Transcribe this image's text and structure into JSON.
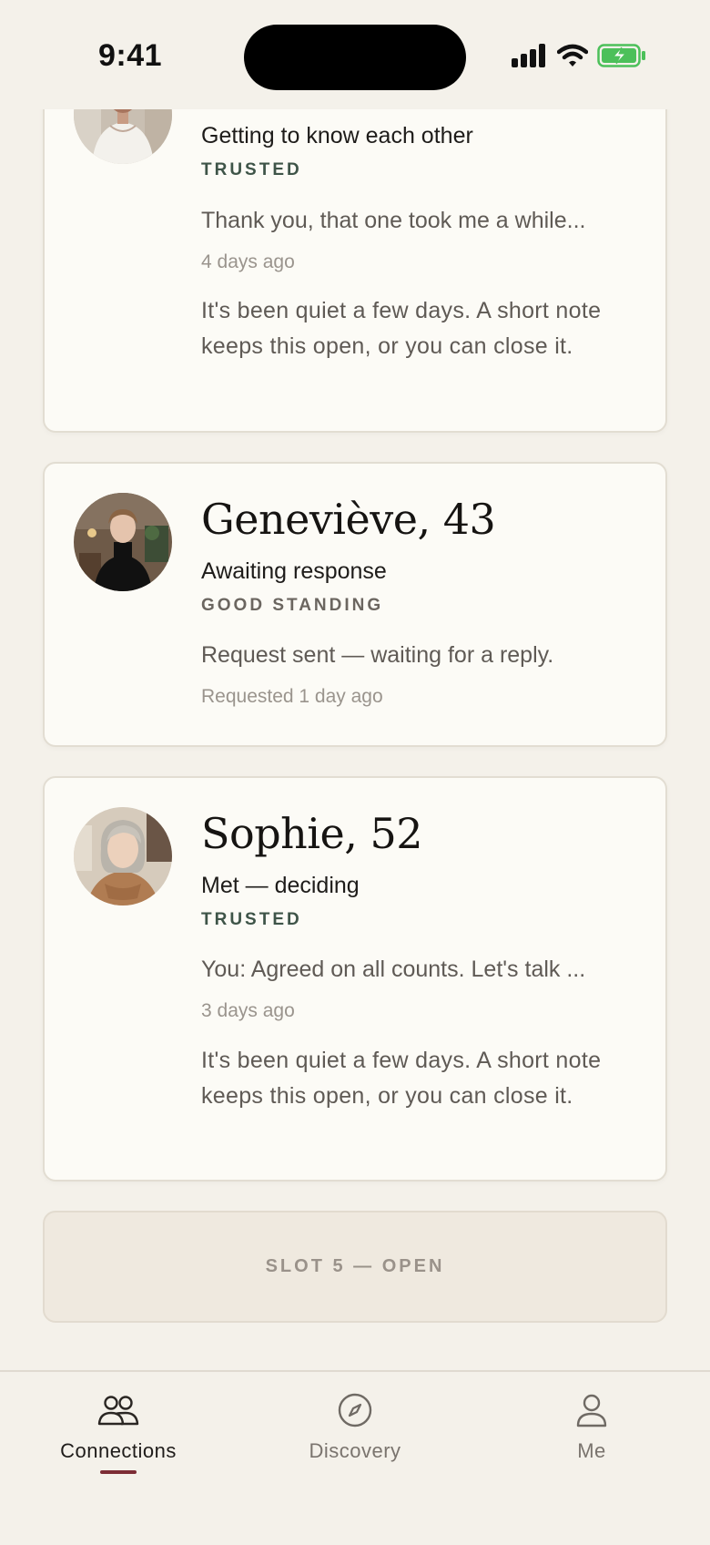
{
  "status_bar": {
    "time": "9:41"
  },
  "cards": [
    {
      "name": "",
      "status": "Getting to know each other",
      "standing": "TRUSTED",
      "preview": "Thank you, that one took me a while...",
      "time": "4 days ago",
      "nudge": "It's been quiet a few days. A short note keeps this open, or you can close it."
    },
    {
      "name": "Geneviève, 43",
      "status": "Awaiting response",
      "standing": "GOOD STANDING",
      "preview": "Request sent — waiting for a reply.",
      "time": "Requested 1 day ago"
    },
    {
      "name": "Sophie, 52",
      "status": "Met — deciding",
      "standing": "TRUSTED",
      "preview": "You: Agreed on all counts. Let's talk ...",
      "time": "3 days ago",
      "nudge": "It's been quiet a few days. A short note keeps this open, or you can close it."
    }
  ],
  "slot": {
    "label": "SLOT 5 — OPEN"
  },
  "tabbar": {
    "items": [
      {
        "label": "Connections",
        "icon": "people-icon",
        "active": true
      },
      {
        "label": "Discovery",
        "icon": "compass-icon",
        "active": false
      },
      {
        "label": "Me",
        "icon": "person-icon",
        "active": false
      }
    ]
  },
  "colors": {
    "background": "#f4f1ea",
    "card": "#fcfbf6",
    "trusted": "#3e5448",
    "accent": "#7c2d35",
    "battery": "#4cc05a"
  }
}
